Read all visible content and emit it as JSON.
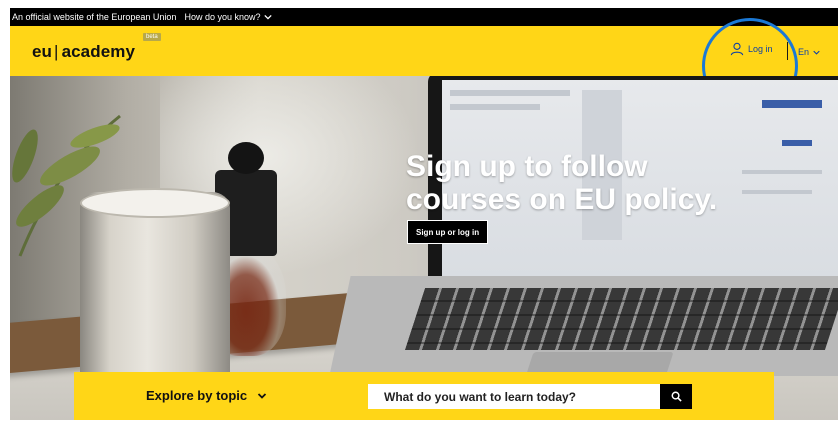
{
  "eu_banner": {
    "official_text": "An official website of the European Union",
    "how_text": "How do you know?"
  },
  "header": {
    "logo_eu": "eu",
    "logo_separator": "|",
    "logo_academy": "academy",
    "beta_badge": "beta",
    "login_label": "Log in",
    "language_label": "En"
  },
  "hero": {
    "title": "Sign up to follow courses on EU policy.",
    "cta_label": "Sign up or log in"
  },
  "explore": {
    "topic_label": "Explore by topic",
    "search_placeholder": "What do you want to learn today?"
  },
  "colors": {
    "brand_yellow": "#ffd617",
    "link_blue": "#0b3fa6",
    "highlight_circle": "#1b79d6"
  },
  "icons": {
    "chevron": "chevron-down-icon",
    "user": "user-icon",
    "search": "search-icon"
  }
}
